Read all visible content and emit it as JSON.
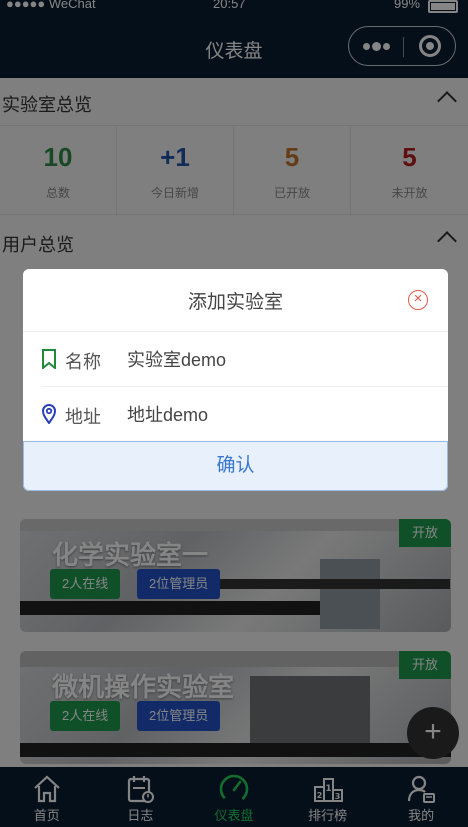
{
  "status_bar": {
    "signal": "●●●●● WeChat",
    "time": "20:57",
    "battery": "99%"
  },
  "navbar": {
    "title": "仪表盘"
  },
  "lab_overview": {
    "title": "实验室总览",
    "stats": [
      {
        "value": "10",
        "label": "总数",
        "color": "#2e8b45"
      },
      {
        "value": "+1",
        "label": "今日新增",
        "color": "#2455a8"
      },
      {
        "value": "5",
        "label": "已开放",
        "color": "#c0762f"
      },
      {
        "value": "5",
        "label": "未开放",
        "color": "#b51f1f"
      }
    ]
  },
  "user_overview": {
    "title": "用户总览"
  },
  "labs": [
    {
      "name": "化学实验室一",
      "online": "2人在线",
      "admins": "2位管理员",
      "status": "开放"
    },
    {
      "name": "微机操作实验室",
      "online": "2人在线",
      "admins": "2位管理员",
      "status": "开放"
    }
  ],
  "fab": {
    "label": "+"
  },
  "tabbar": [
    {
      "label": "首页",
      "icon": "home-icon"
    },
    {
      "label": "日志",
      "icon": "calendar-log-icon"
    },
    {
      "label": "仪表盘",
      "icon": "gauge-icon",
      "active": true
    },
    {
      "label": "排行榜",
      "icon": "podium-ranking-icon"
    },
    {
      "label": "我的",
      "icon": "user-profile-icon"
    }
  ],
  "modal": {
    "title": "添加实验室",
    "name_label": "名称",
    "name_value": "实验室demo",
    "address_label": "地址",
    "address_value": "地址demo",
    "confirm_label": "确认"
  }
}
